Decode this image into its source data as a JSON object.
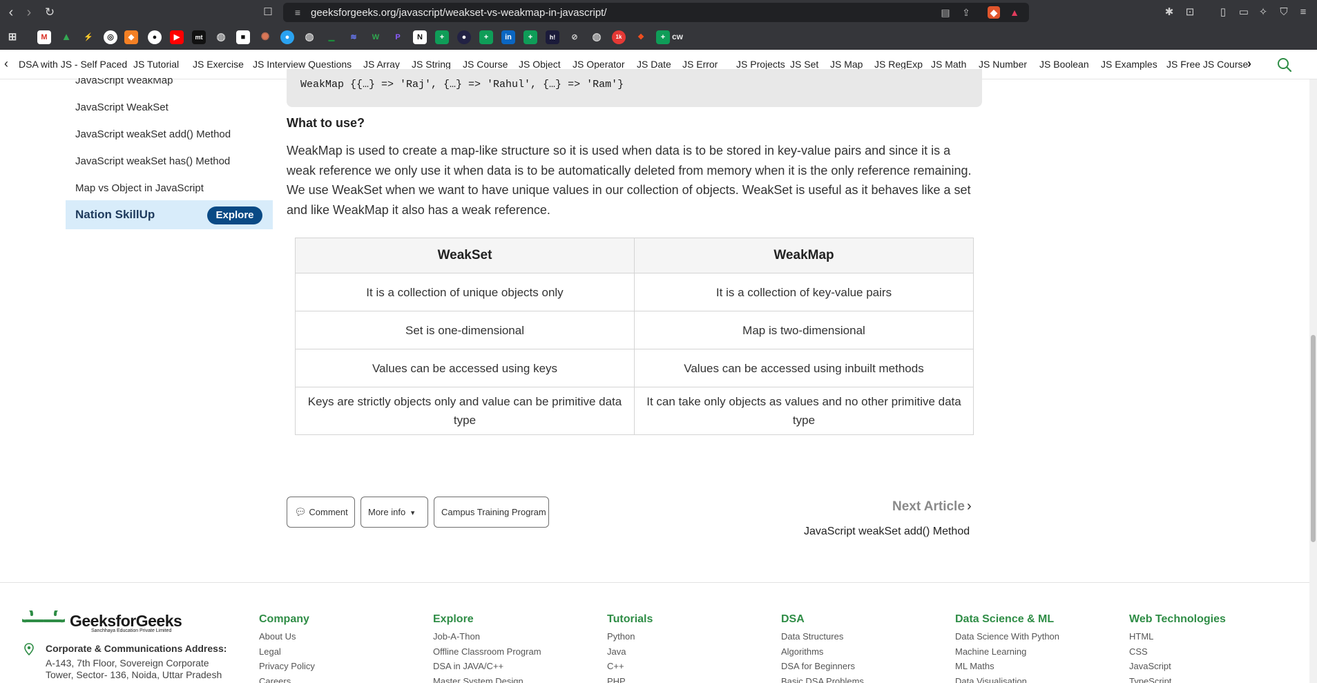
{
  "browser": {
    "url": "geeksforgeeks.org/javascript/weakset-vs-weakmap-in-javascript/",
    "bookmark_text": "cw"
  },
  "topic_strip": {
    "items": [
      "DSA with JS - Self Paced",
      "JS Tutorial",
      "JS Exercise",
      "JS Interview Questions",
      "JS Array",
      "JS String",
      "JS Course",
      "JS Object",
      "JS Operator",
      "JS Date",
      "JS Error",
      "JS Projects",
      "JS Set",
      "JS Map",
      "JS RegExp",
      "JS Math",
      "JS Number",
      "JS Boolean",
      "JS Examples",
      "JS Free JS Course"
    ]
  },
  "sidebar": {
    "items": [
      "JavaScript WeakMap",
      "JavaScript WeakSet",
      "JavaScript weakSet add() Method",
      "JavaScript weakSet has() Method",
      "Map vs Object in JavaScript"
    ],
    "promo_label": "Nation SkillUp",
    "promo_button": "Explore"
  },
  "article": {
    "code_output": "WeakMap {{…} => 'Raj', {…} => 'Rahul', {…} => 'Ram'}",
    "heading": "What to use?",
    "paragraph": "WeakMap is used to create a map-like structure so it is used when data is to be stored in key-value pairs and since it is a weak reference we only use it when data is to be automatically deleted from memory when it is the only reference remaining. We use WeakSet when we want to have unique values in our collection of objects. WeakSet is useful as it behaves like a set and like WeakMap it also has a weak reference.",
    "table": {
      "headers": [
        "WeakSet",
        "WeakMap"
      ],
      "rows": [
        [
          "It is a collection of unique objects only",
          "It is a collection of key-value pairs"
        ],
        [
          "Set is one-dimensional",
          "Map is two-dimensional"
        ],
        [
          "Values can be accessed using keys",
          "Values can be accessed using inbuilt methods"
        ],
        [
          "Keys are strictly objects only and value can be primitive data type",
          "It can take only objects as values and no other primitive data type"
        ]
      ]
    }
  },
  "actions": {
    "comment": "Comment",
    "more_info": "More info",
    "campus": "Campus Training Program"
  },
  "next_article": {
    "label": "Next Article",
    "title": "JavaScript weakSet add() Method"
  },
  "footer": {
    "logo_text": "GeeksforGeeks",
    "logo_sub": "Sanchhaya Education Private Limited",
    "address_heading": "Corporate & Communications Address:",
    "address_line1": "A-143, 7th Floor, Sovereign Corporate",
    "address_line2": "Tower, Sector- 136, Noida, Uttar Pradesh",
    "columns": [
      {
        "heading": "Company",
        "links": [
          "About Us",
          "Legal",
          "Privacy Policy",
          "Careers"
        ]
      },
      {
        "heading": "Explore",
        "links": [
          "Job-A-Thon",
          "Offline Classroom Program",
          "DSA in JAVA/C++",
          "Master System Design"
        ]
      },
      {
        "heading": "Tutorials",
        "links": [
          "Python",
          "Java",
          "C++",
          "PHP"
        ]
      },
      {
        "heading": "DSA",
        "links": [
          "Data Structures",
          "Algorithms",
          "DSA for Beginners",
          "Basic DSA Problems"
        ]
      },
      {
        "heading": "Data Science & ML",
        "links": [
          "Data Science With Python",
          "Machine Learning",
          "ML Maths",
          "Data Visualisation"
        ]
      },
      {
        "heading": "Web Technologies",
        "links": [
          "HTML",
          "CSS",
          "JavaScript",
          "TypeScript"
        ]
      }
    ]
  },
  "colors": {
    "brand_green": "#2f8d46",
    "explore_blue": "#0a4a85",
    "promo_bg": "#d8ecfa"
  }
}
